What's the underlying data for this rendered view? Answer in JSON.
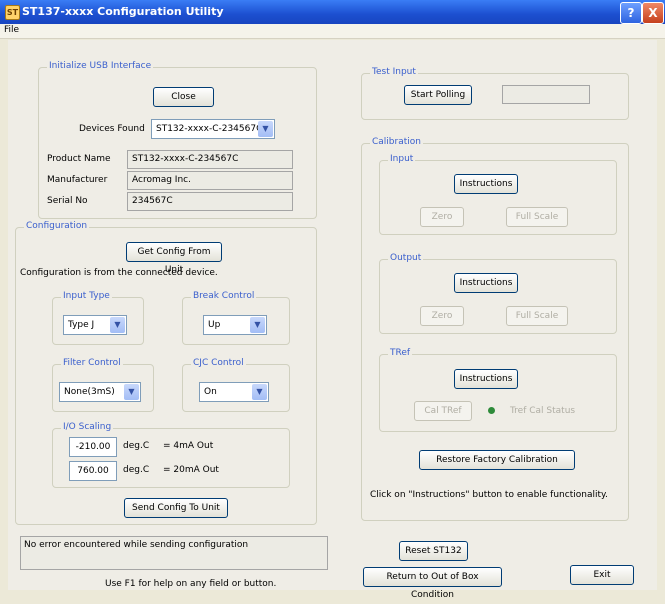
{
  "window": {
    "title": "ST137-xxxx Configuration Utility",
    "help_label": "?",
    "close_label": "X",
    "app_icon": "ST"
  },
  "menu": {
    "file": "File"
  },
  "usb": {
    "group_label": "Initialize USB Interface",
    "close_button": "Close",
    "devices_found_label": "Devices Found",
    "devices_found_value": "ST132-xxxx-C-234567C",
    "product_name_label": "Product Name",
    "product_name_value": "ST132-xxxx-C-234567C",
    "manufacturer_label": "Manufacturer",
    "manufacturer_value": "Acromag Inc.",
    "serial_label": "Serial No",
    "serial_value": "234567C"
  },
  "configuration": {
    "group_label": "Configuration",
    "get_config_button": "Get Config From Unit",
    "status_text": "Configuration is from the connected device.",
    "input_type": {
      "label": "Input Type",
      "value": "Type J"
    },
    "break_control": {
      "label": "Break Control",
      "value": "Up"
    },
    "filter_control": {
      "label": "Filter Control",
      "value": "None(3mS)"
    },
    "cjc_control": {
      "label": "CJC Control",
      "value": "On"
    },
    "io_scaling": {
      "label": "I/O Scaling",
      "low_value": "-210.00",
      "low_unit": "deg.C",
      "low_out": "= 4mA Out",
      "high_value": "760.00",
      "high_unit": "deg.C",
      "high_out": "= 20mA Out"
    },
    "send_button": "Send Config To Unit"
  },
  "test_input": {
    "group_label": "Test Input",
    "start_button": "Start Polling",
    "readout": ""
  },
  "calibration": {
    "group_label": "Calibration",
    "input": {
      "label": "Input",
      "instructions": "Instructions",
      "zero": "Zero",
      "full_scale": "Full Scale"
    },
    "output": {
      "label": "Output",
      "instructions": "Instructions",
      "zero": "Zero",
      "full_scale": "Full Scale"
    },
    "tref": {
      "label": "TRef",
      "instructions": "Instructions",
      "cal_button": "Cal TRef",
      "status_label": "Tref Cal Status"
    },
    "restore_button": "Restore Factory Calibration",
    "hint": "Click on \"Instructions\" button to enable functionality."
  },
  "status": {
    "message": "No error encountered while sending configuration",
    "help_hint": "Use F1 for help on any field or button."
  },
  "footer": {
    "reset_button": "Reset ST132",
    "return_button": "Return to Out of Box Condition",
    "exit_button": "Exit"
  },
  "colors": {
    "titlebar": "#1c4fd0",
    "group_label": "#3a5fcd",
    "status_dot": "#2e8b3a"
  }
}
